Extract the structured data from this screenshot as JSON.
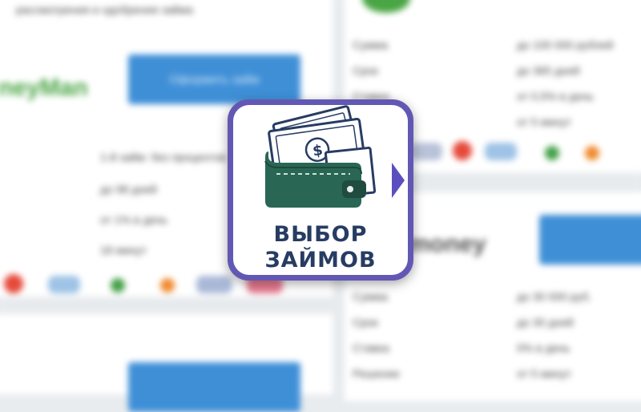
{
  "app_icon": {
    "caption_line1": "ВЫБОР",
    "caption_line2": "ЗАЙМОВ",
    "icon": "wallet-with-cash-icon",
    "colors": {
      "frame": "#6258b4",
      "wallet": "#2a6654",
      "text": "#273c63",
      "arrow": "#5b4fc0"
    }
  },
  "background": {
    "left_brand": "neyMan",
    "right_brand": "money",
    "top_tagline": "рассмотрения и одобрения займа",
    "apply_button_label": "Оформить займ",
    "offer_lines_left": [
      "1-й займ: без процентов",
      "до 98 дней",
      "от 1% в день",
      "18 минут"
    ],
    "offer_lines_right": [
      "до 100 000 рублей",
      "до 365 дней",
      "от 0,5% в день",
      "от 5 минут"
    ]
  }
}
